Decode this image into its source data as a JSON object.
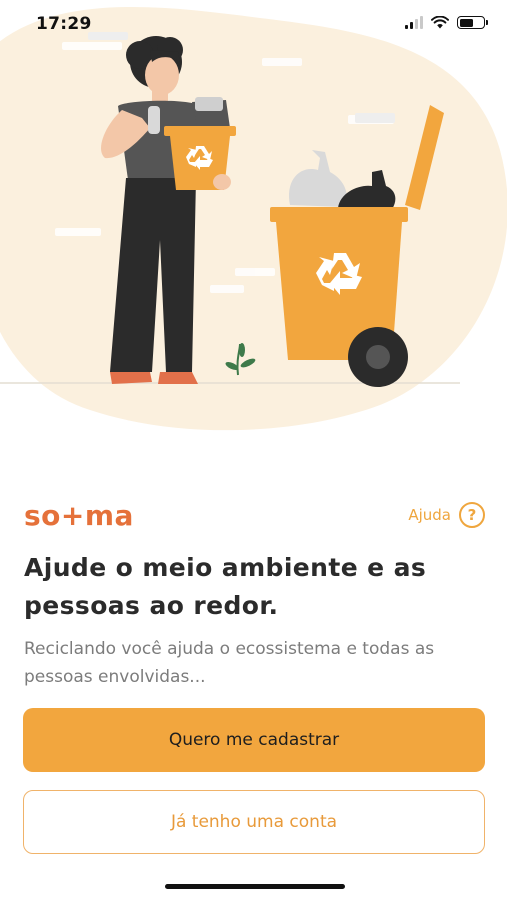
{
  "status_bar": {
    "time": "17:29"
  },
  "brand": {
    "logo_text": "so+ma",
    "color": "#e5713a"
  },
  "help": {
    "label": "Ajuda",
    "icon": "?"
  },
  "headline": "Ajude o meio ambiente e as pessoas ao redor.",
  "subtext": "Reciclando você ajuda o ecossistema e todas as pessoas envolvidas...",
  "actions": {
    "primary_label": "Quero me cadastrar",
    "secondary_label": "Já tenho uma conta"
  },
  "colors": {
    "accent": "#f2a63e",
    "background_blob": "#fbf0de"
  },
  "illustration": {
    "subject": "person holding recycling bin next to large recycling container"
  }
}
